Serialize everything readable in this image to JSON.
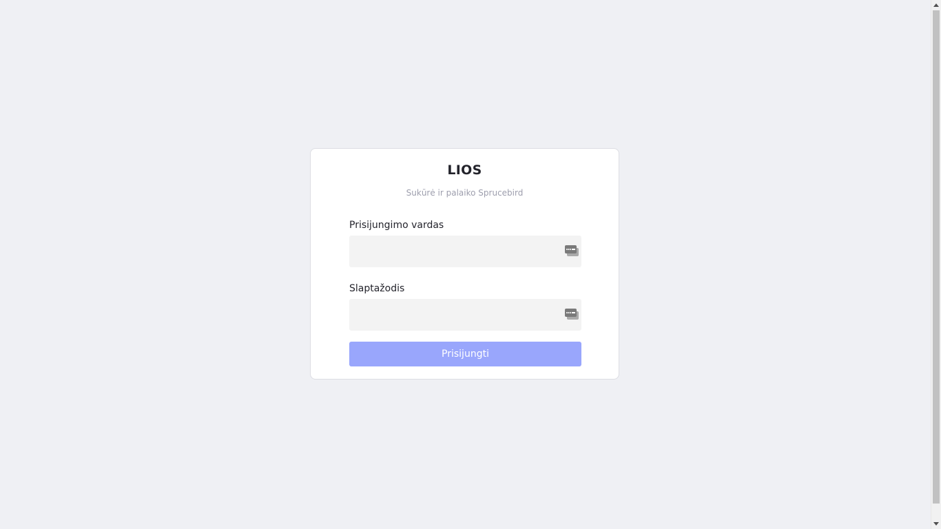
{
  "app": {
    "title": "LIOS",
    "subtitle": "Sukūrė ir palaiko Sprucebird"
  },
  "login_form": {
    "username_label": "Prisijungimo vardas",
    "username_value": "",
    "username_placeholder": "",
    "password_label": "Slaptažodis",
    "password_value": "",
    "password_placeholder": "",
    "submit_label": "Prisijungti"
  },
  "icons": {
    "field_icon": "password-manager-key-icon"
  },
  "colors": {
    "page_background": "#eff0f4",
    "card_background": "#ffffff",
    "field_background": "#f3f3f3",
    "button_background": "#99a6fc",
    "button_text": "#ffffff",
    "title_text": "#23232b",
    "subtitle_text": "#9d9ead"
  }
}
